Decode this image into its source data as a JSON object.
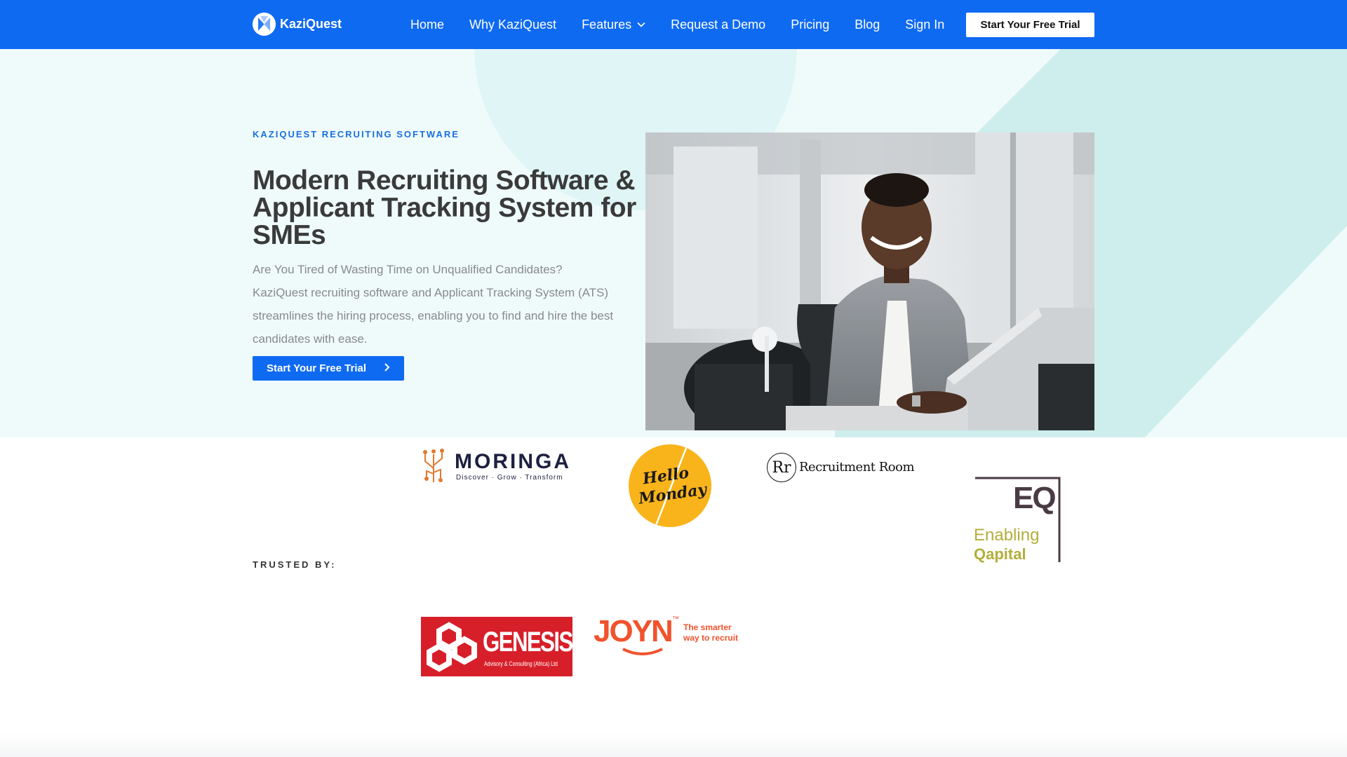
{
  "nav": {
    "brand": "KaziQuest",
    "links": [
      "Home",
      "Why KaziQuest",
      "Features",
      "Request a Demo",
      "Pricing",
      "Blog",
      "Sign In"
    ],
    "cta": "Start Your Free Trial"
  },
  "hero": {
    "eyebrow": "KAZIQUEST RECRUITING SOFTWARE",
    "title": "Modern Recruiting Software & Applicant Tracking System for SMEs",
    "description": "Are You Tired of Wasting Time on Unqualified Candidates? KaziQuest recruiting software and Applicant Tracking System (ATS) streamlines the hiring process, enabling you to find and hire the best candidates with ease.",
    "button": "Start Your Free Trial"
  },
  "trusted": {
    "label": "TRUSTED BY:",
    "logos": {
      "moringa": {
        "name": "MORINGA",
        "tagline": "Discover · Grow · Transform"
      },
      "hello_monday": {
        "line1": "Hello",
        "line2": "Monday"
      },
      "recruitment_room": {
        "monogram": "Rr",
        "name": "Recruitment Room"
      },
      "eq": {
        "mark": "EQ",
        "line1": "Enabling",
        "line2": "Qapital"
      },
      "genesis": {
        "name": "GENESIS",
        "sub": "Advisory & Consulting (Africa) Ltd"
      },
      "joyn": {
        "name": "JOYN",
        "tm": "™",
        "tagline1": "The smarter",
        "tagline2": "way to recruit"
      }
    }
  },
  "colors": {
    "brand_blue": "#0f6af2",
    "hero_bg": "#effbfb",
    "teal_accent": "#cdeeec",
    "hello_monday_yellow": "#f9b41b",
    "genesis_red": "#d71f2a",
    "joyn_orange": "#f0532d",
    "eq_olive": "#b3ae3b"
  }
}
